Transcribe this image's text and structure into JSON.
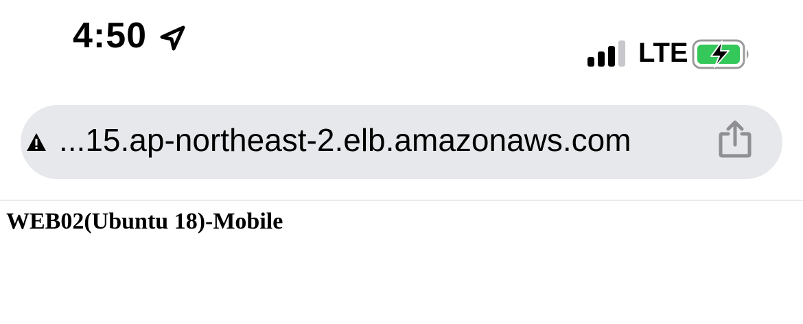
{
  "status_bar": {
    "time": "4:50",
    "network": "LTE",
    "icons": [
      "location-arrow-icon",
      "signal-strength-icon",
      "battery-charging-icon"
    ],
    "battery_color": "#34c759"
  },
  "address_bar": {
    "url": "...15.ap-northeast-2.elb.amazonaws.com",
    "security_icon": "warning-icon",
    "action_icon": "share-icon",
    "background": "#e6e8eb"
  },
  "page": {
    "heading": "WEB02(Ubuntu 18)-Mobile"
  }
}
